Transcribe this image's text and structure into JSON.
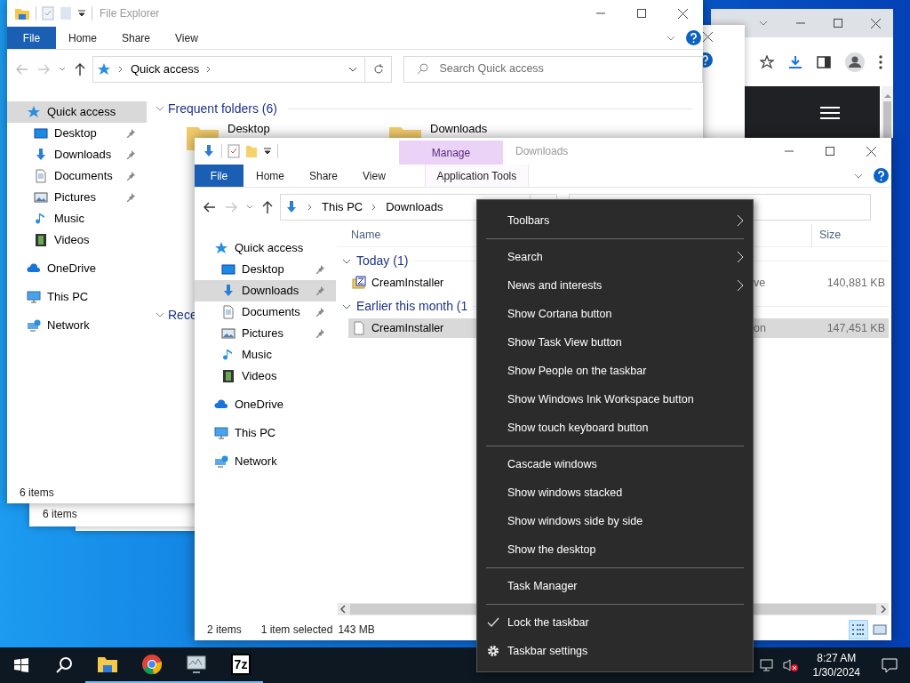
{
  "back_window": {
    "status_bar": "6 items"
  },
  "quick_access_window": {
    "title": "File Explorer",
    "ribbon_tabs": [
      {
        "label": "File",
        "kind": "file"
      },
      {
        "label": "Home",
        "kind": "tab"
      },
      {
        "label": "Share",
        "kind": "tab"
      },
      {
        "label": "View",
        "kind": "tab"
      }
    ],
    "address": {
      "path": [
        "Quick access"
      ]
    },
    "search": {
      "placeholder": "Search Quick access"
    },
    "nav": [
      {
        "label": "Quick access",
        "kind": "quick-access",
        "selected": true,
        "children": [
          {
            "label": "Desktop",
            "kind": "desktop",
            "pinned": true,
            "selected": false
          },
          {
            "label": "Downloads",
            "kind": "downloads",
            "pinned": true,
            "selected": false
          },
          {
            "label": "Documents",
            "kind": "documents",
            "pinned": true,
            "selected": false
          },
          {
            "label": "Pictures",
            "kind": "pictures",
            "pinned": true,
            "selected": false
          },
          {
            "label": "Music",
            "kind": "music",
            "pinned": false,
            "selected": false
          },
          {
            "label": "Videos",
            "kind": "videos",
            "pinned": false,
            "selected": false
          }
        ]
      },
      {
        "label": "OneDrive",
        "kind": "onedrive",
        "selected": false
      },
      {
        "label": "This PC",
        "kind": "this-pc",
        "selected": false
      },
      {
        "label": "Network",
        "kind": "network",
        "selected": false
      }
    ],
    "sections": [
      {
        "title": "Frequent folders (6)",
        "folders": [
          "Desktop",
          "Downloads"
        ]
      },
      {
        "title": "Rece"
      }
    ],
    "status_bar": "6 items"
  },
  "downloads_window": {
    "title": "Downloads",
    "contextual_tab": {
      "group": "Manage",
      "label": "Application Tools"
    },
    "ribbon_tabs": [
      {
        "label": "File",
        "kind": "file"
      },
      {
        "label": "Home",
        "kind": "tab"
      },
      {
        "label": "Share",
        "kind": "tab"
      },
      {
        "label": "View",
        "kind": "tab"
      }
    ],
    "address": {
      "path": [
        "This PC",
        "Downloads"
      ]
    },
    "nav": [
      {
        "label": "Quick access",
        "kind": "quick-access",
        "selected": false,
        "children": [
          {
            "label": "Desktop",
            "kind": "desktop",
            "pinned": true,
            "selected": false
          },
          {
            "label": "Downloads",
            "kind": "downloads",
            "pinned": true,
            "selected": true
          },
          {
            "label": "Documents",
            "kind": "documents",
            "pinned": true,
            "selected": false
          },
          {
            "label": "Pictures",
            "kind": "pictures",
            "pinned": true,
            "selected": false
          },
          {
            "label": "Music",
            "kind": "music",
            "pinned": false,
            "selected": false
          },
          {
            "label": "Videos",
            "kind": "videos",
            "pinned": false,
            "selected": false
          }
        ]
      },
      {
        "label": "OneDrive",
        "kind": "onedrive",
        "selected": false
      },
      {
        "label": "This PC",
        "kind": "this-pc",
        "selected": false
      },
      {
        "label": "Network",
        "kind": "network",
        "selected": false
      }
    ],
    "columns": {
      "name": "Name",
      "size": "Size"
    },
    "groups": [
      {
        "title": "Today (1)",
        "files": [
          {
            "name": "CreamInstaller",
            "kind": "archive",
            "column_3": "ve",
            "size": "140,881 KB",
            "selected": false
          }
        ]
      },
      {
        "title": "Earlier this month (1",
        "files": [
          {
            "name": "CreamInstaller",
            "kind": "document",
            "column_3": "on",
            "size": "147,451 KB",
            "selected": true
          }
        ]
      }
    ],
    "status_bar": {
      "items": "2 items",
      "selection": "1 item selected",
      "size": "143 MB"
    },
    "view_buttons": [
      {
        "kind": "details",
        "selected": true
      },
      {
        "kind": "large-icons",
        "selected": false
      }
    ]
  },
  "context_menu": {
    "items": [
      {
        "kind": "submenu",
        "label": "Toolbars"
      },
      {
        "kind": "separator"
      },
      {
        "kind": "submenu",
        "label": "Search"
      },
      {
        "kind": "submenu",
        "label": "News and interests"
      },
      {
        "kind": "toggle",
        "label": "Show Cortana button",
        "checked": false
      },
      {
        "kind": "toggle",
        "label": "Show Task View button",
        "checked": false
      },
      {
        "kind": "toggle",
        "label": "Show People on the taskbar",
        "checked": false
      },
      {
        "kind": "toggle",
        "label": "Show Windows Ink Workspace button",
        "checked": false
      },
      {
        "kind": "toggle",
        "label": "Show touch keyboard button",
        "checked": false
      },
      {
        "kind": "separator"
      },
      {
        "kind": "command",
        "label": "Cascade windows"
      },
      {
        "kind": "command",
        "label": "Show windows stacked"
      },
      {
        "kind": "command",
        "label": "Show windows side by side"
      },
      {
        "kind": "command",
        "label": "Show the desktop"
      },
      {
        "kind": "separator"
      },
      {
        "kind": "command",
        "label": "Task Manager"
      },
      {
        "kind": "separator"
      },
      {
        "kind": "toggle",
        "label": "Lock the taskbar",
        "checked": true
      },
      {
        "kind": "settings",
        "label": "Taskbar settings"
      }
    ]
  },
  "taskbar": {
    "apps": [
      {
        "kind": "file-explorer",
        "running": true
      },
      {
        "kind": "browser",
        "running": true
      },
      {
        "kind": "monitor",
        "running": true
      },
      {
        "kind": "archiver",
        "logo_text": "7z",
        "running": true
      }
    ],
    "clock": {
      "time": "8:27 AM",
      "date": "1/30/2024"
    }
  }
}
